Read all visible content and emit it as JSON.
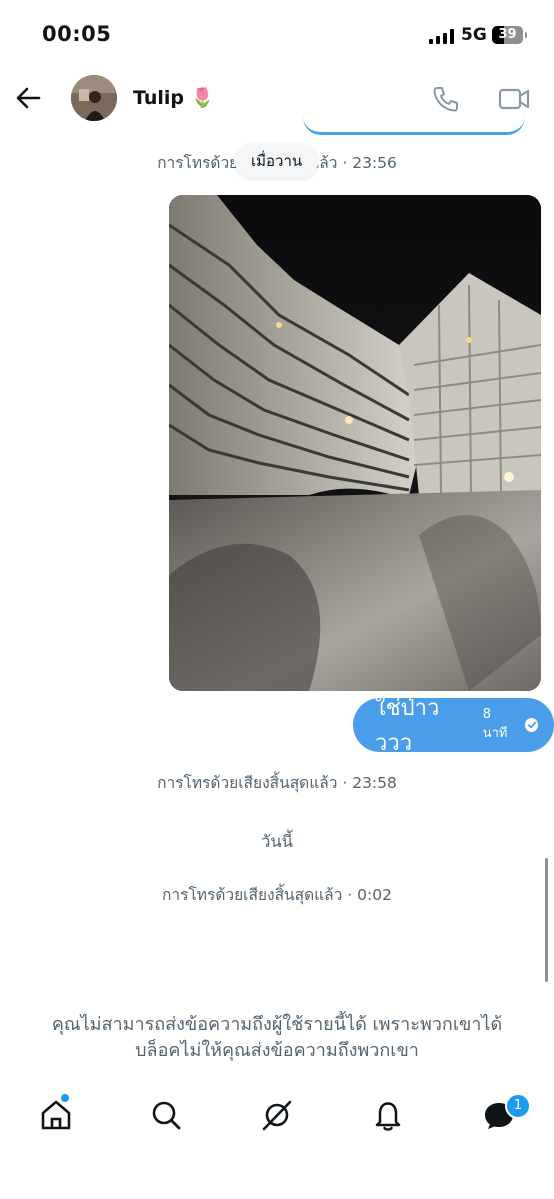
{
  "status_bar": {
    "time": "00:05",
    "network": "5G",
    "battery": "39",
    "battery_level": 0.39
  },
  "header": {
    "contact_name": "Tulip 🌷"
  },
  "messages": {
    "call_ended_1": "การโทรด้วยเสียงสิ้นสุดแล้ว · 23:56",
    "date_pill": "เมื่อวาน",
    "bubble_text": "ใช่ป่าวววว",
    "bubble_time": "8 นาที",
    "call_ended_2": "การโทรด้วยเสียงสิ้นสุดแล้ว · 23:58",
    "today_label": "วันนี้",
    "call_ended_3": "การโทรด้วยเสียงสิ้นสุดแล้ว · 0:02"
  },
  "blocked_notice": {
    "line1": "คุณไม่สามารถส่งข้อความถึงผู้ใช้รายนี้ได้ เพราะพวกเขาได้",
    "line2": "บล็อคไม่ให้คุณส่งข้อความถึงพวกเขา"
  },
  "bottom_nav": {
    "messages_badge": "1"
  },
  "colors": {
    "accent": "#1d9bf0",
    "bubble": "#4a9ee9",
    "muted_text": "#536471"
  }
}
